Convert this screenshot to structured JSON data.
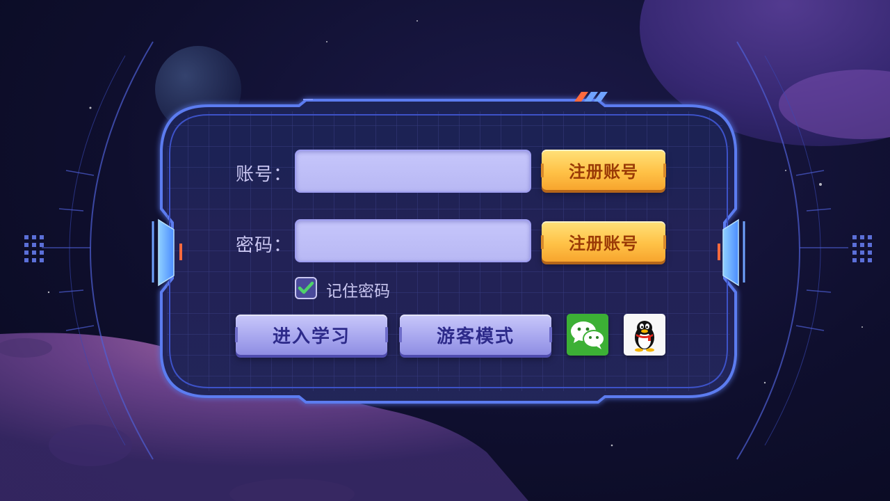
{
  "login": {
    "account_label": "账号：",
    "password_label": "密码：",
    "account_value": "",
    "password_value": "",
    "register_button_1": "注册账号",
    "register_button_2": "注册账号",
    "remember_label": "记住密码",
    "remember_checked": true,
    "enter_button": "进入学习",
    "guest_button": "游客模式"
  },
  "social": {
    "wechat_icon": "wechat-icon",
    "qq_icon": "qq-penguin-icon"
  },
  "colors": {
    "accent_orange": "#ffc247",
    "panel_blue": "#5b7cf0",
    "check_green": "#4fd36a",
    "wechat_green": "#3cb035"
  }
}
